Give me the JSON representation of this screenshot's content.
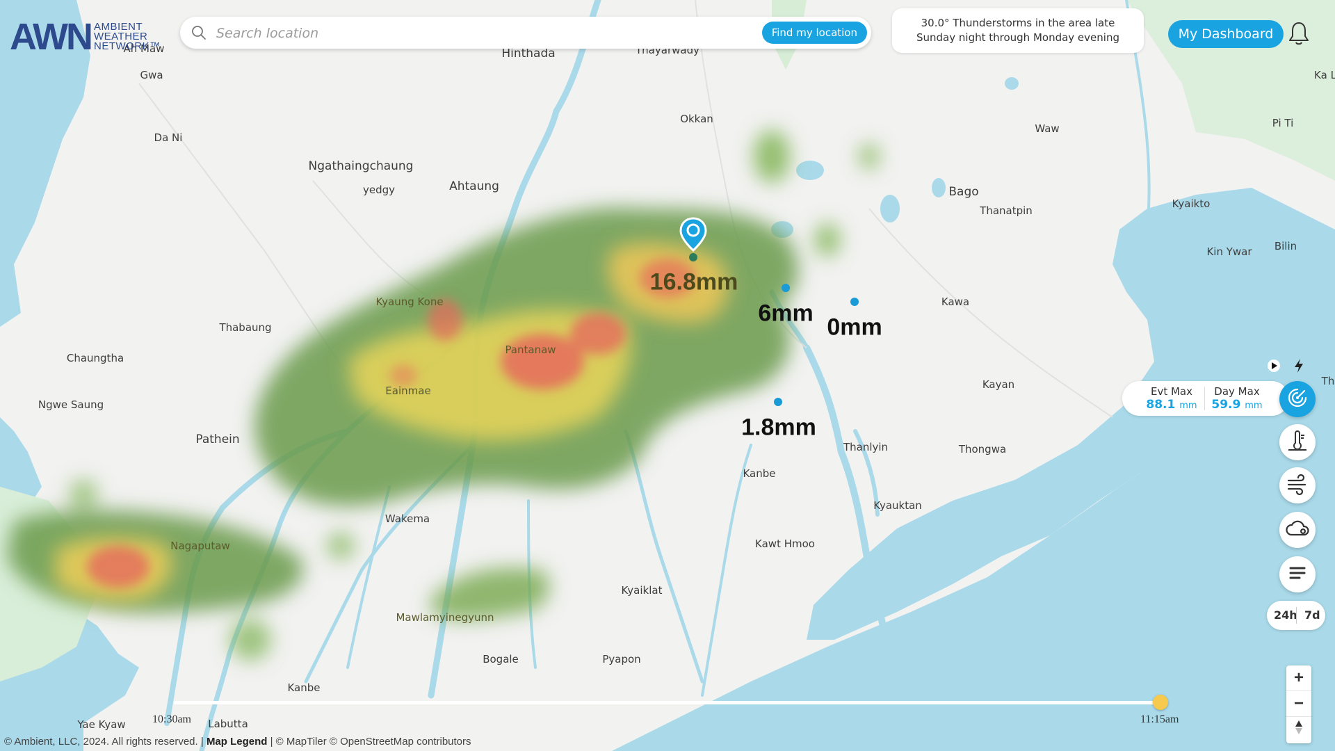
{
  "app": {
    "logo_mark": "AWN",
    "logo_lines": [
      "AMBIENT",
      "WEATHER",
      "NETWORK™"
    ]
  },
  "search": {
    "placeholder": "Search location",
    "find_button": "Find my location"
  },
  "forecast": {
    "text": "30.0°  Thunderstorms in the area late Sunday night through Monday evening"
  },
  "header": {
    "dashboard_button": "My Dashboard"
  },
  "places": [
    {
      "name": "Ah Maw",
      "size": "small"
    },
    {
      "name": "Gwa",
      "size": "small"
    },
    {
      "name": "Da Ni",
      "size": "small"
    },
    {
      "name": "Hinthada",
      "size": "med"
    },
    {
      "name": "Thayarwady",
      "size": "small"
    },
    {
      "name": "Okkan",
      "size": "small"
    },
    {
      "name": "Ngathaingchaung",
      "size": "med"
    },
    {
      "name": "Ahtaung",
      "size": "med"
    },
    {
      "name": "yedgy",
      "size": "small"
    },
    {
      "name": "Waw",
      "size": "small"
    },
    {
      "name": "Bago",
      "size": "med"
    },
    {
      "name": "Thanatpin",
      "size": "small"
    },
    {
      "name": "Kyaikto",
      "size": "small"
    },
    {
      "name": "Kin Ywar",
      "size": "small"
    },
    {
      "name": "Bilin",
      "size": "small"
    },
    {
      "name": "Pi Ti",
      "size": "small"
    },
    {
      "name": "Ka L",
      "size": "small"
    },
    {
      "name": "Kyaung Kone",
      "size": "small"
    },
    {
      "name": "Thabaung",
      "size": "small"
    },
    {
      "name": "Kawa",
      "size": "small"
    },
    {
      "name": "Chaungtha",
      "size": "small"
    },
    {
      "name": "Pantanaw",
      "size": "small"
    },
    {
      "name": "Ngwe Saung",
      "size": "small"
    },
    {
      "name": "Eainmae",
      "size": "small"
    },
    {
      "name": "Kayan",
      "size": "small"
    },
    {
      "name": "Th",
      "size": "small"
    },
    {
      "name": "Pathein",
      "size": "med"
    },
    {
      "name": "Thanlyin",
      "size": "small"
    },
    {
      "name": "Thongwa",
      "size": "small"
    },
    {
      "name": "Kanbe",
      "size": "small"
    },
    {
      "name": "Kyauktan",
      "size": "small"
    },
    {
      "name": "Wakema",
      "size": "small"
    },
    {
      "name": "Nagaputaw",
      "size": "small"
    },
    {
      "name": "Kawt Hmoo",
      "size": "small"
    },
    {
      "name": "Kyaiklat",
      "size": "small"
    },
    {
      "name": "Mawlamyinegyunn",
      "size": "small"
    },
    {
      "name": "Bogale",
      "size": "small"
    },
    {
      "name": "Pyapon",
      "size": "small"
    },
    {
      "name": "Kanbe",
      "size": "small"
    },
    {
      "name": "Yae Kyaw",
      "size": "small"
    },
    {
      "name": "Labutta",
      "size": "small"
    }
  ],
  "stations": [
    {
      "rain": "16.8mm"
    },
    {
      "rain": "6mm"
    },
    {
      "rain": "0mm"
    },
    {
      "rain": "1.8mm"
    }
  ],
  "max_panel": {
    "evt_label": "Evt Max",
    "evt_value": "88.1",
    "evt_unit": "mm",
    "day_label": "Day Max",
    "day_value": "59.9",
    "day_unit": "mm"
  },
  "controls": {
    "icons": [
      "play-icon",
      "lightning-icon",
      "radar-icon",
      "temperature-icon",
      "wind-icon",
      "cloud-icon",
      "menu-icon"
    ],
    "range_24h": "24h",
    "range_7d": "7d",
    "zoom_in": "+",
    "zoom_out": "−"
  },
  "timeline": {
    "start": "10:30am",
    "end": "11:15am",
    "position": 1.0
  },
  "footer": {
    "copyright": "© Ambient, LLC, 2024. All rights reserved. | ",
    "legend": "Map Legend",
    "attribution": " | © MapTiler © OpenStreetMap contributors"
  },
  "colors": {
    "accent": "#19a3e0",
    "water": "#aadaea",
    "land": "#f2f2f2",
    "timeline_thumb": "#f7c94c"
  }
}
